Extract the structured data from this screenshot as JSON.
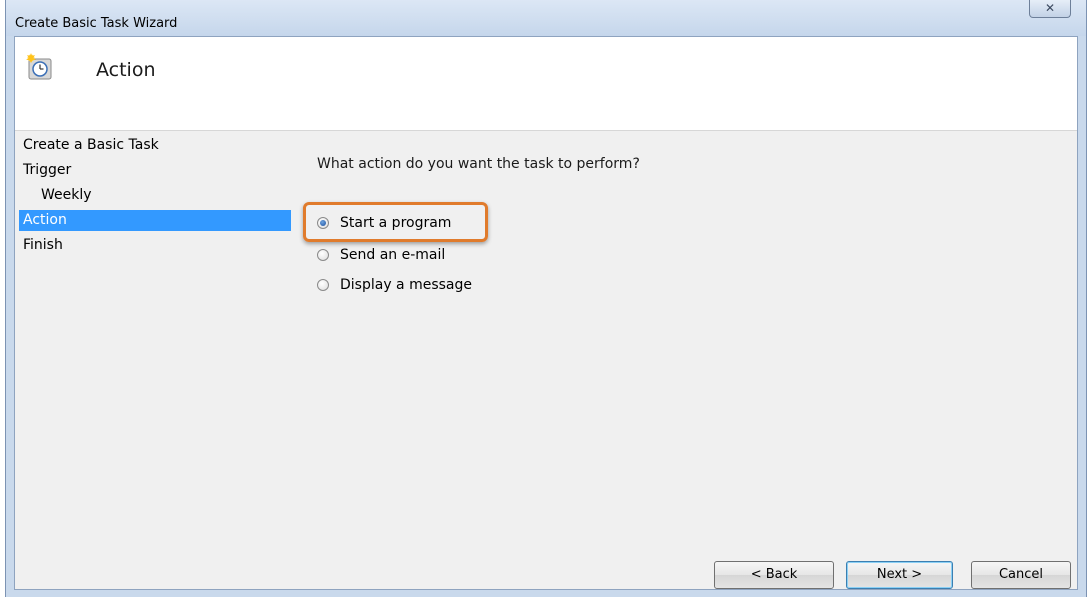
{
  "window": {
    "title": "Create Basic Task Wizard",
    "close_glyph": "✕"
  },
  "header": {
    "icon": "clock-icon",
    "title": "Action"
  },
  "nav": {
    "items": [
      {
        "label": "Create a Basic Task",
        "level": 0,
        "selected": false
      },
      {
        "label": "Trigger",
        "level": 0,
        "selected": false
      },
      {
        "label": "Weekly",
        "level": 1,
        "selected": false
      },
      {
        "label": "Action",
        "level": 0,
        "selected": true
      },
      {
        "label": "Finish",
        "level": 0,
        "selected": false
      }
    ]
  },
  "main": {
    "question": "What action do you want the task to perform?",
    "options": [
      {
        "label": "Start a program",
        "checked": true
      },
      {
        "label": "Send an e-mail",
        "checked": false
      },
      {
        "label": "Display a message",
        "checked": false
      }
    ]
  },
  "buttons": {
    "back": "< Back",
    "next": "Next >",
    "cancel": "Cancel"
  },
  "colors": {
    "selection": "#3399ff",
    "highlight": "#e07b2c"
  }
}
